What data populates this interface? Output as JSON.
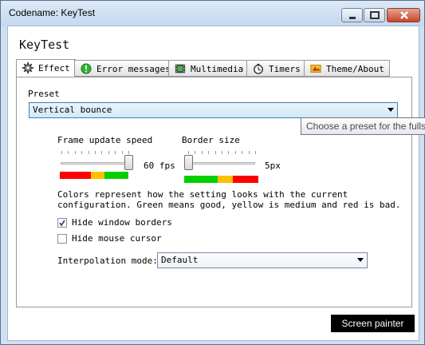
{
  "window": {
    "title": "Codename: KeyTest"
  },
  "app": {
    "heading": "KeyTest"
  },
  "tabs": [
    {
      "label": "Effect",
      "icon": "gear-icon",
      "active": true
    },
    {
      "label": "Error messages",
      "icon": "warning-icon",
      "active": false
    },
    {
      "label": "Multimedia",
      "icon": "film-icon",
      "active": false
    },
    {
      "label": "Timers",
      "icon": "stopwatch-icon",
      "active": false
    },
    {
      "label": "Theme/About",
      "icon": "theme-icon",
      "active": false
    }
  ],
  "preset": {
    "label": "Preset",
    "value": "Vertical bounce",
    "tooltip": "Choose a preset for the fullsc"
  },
  "frame_speed": {
    "label": "Frame update speed",
    "value_text": "60 fps",
    "level": 1.0,
    "quality_colors": [
      "#ff0000",
      "#ffc000",
      "#00d000"
    ]
  },
  "border_size": {
    "label": "Border size",
    "value_text": "5px",
    "level": 0.0,
    "quality_colors": [
      "#00d000",
      "#ffc000",
      "#ff0000"
    ]
  },
  "colors_note": {
    "line1": "Colors represent how the setting looks with the current",
    "line2": "configuration. Green means good, yellow is medium and red is bad."
  },
  "checkboxes": [
    {
      "label": "Hide window borders",
      "checked": true
    },
    {
      "label": "Hide mouse cursor",
      "checked": false
    }
  ],
  "interpolation": {
    "label": "Interpolation mode:",
    "value": "Default"
  },
  "footer": {
    "button_label": "Screen painter"
  }
}
